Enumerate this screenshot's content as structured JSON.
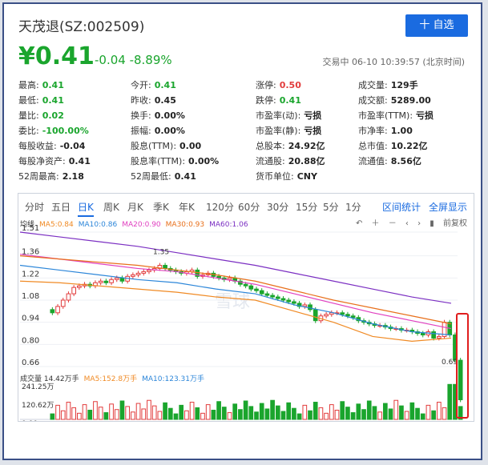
{
  "header": {
    "title": "天茂退(SZ:002509)",
    "add_button": "十 自选"
  },
  "quote": {
    "price": "¥0.41",
    "change": "-0.04 -8.89%",
    "status": "交易中 06-10 10:39:57 (北京时间)"
  },
  "stats": [
    [
      {
        "label": "最高:",
        "value": "0.41",
        "color": "g"
      },
      {
        "label": "今开:",
        "value": "0.41",
        "color": "g"
      },
      {
        "label": "涨停:",
        "value": "0.50",
        "color": "r"
      },
      {
        "label": "成交量:",
        "value": "129手",
        "color": "k"
      }
    ],
    [
      {
        "label": "最低:",
        "value": "0.41",
        "color": "g"
      },
      {
        "label": "昨收:",
        "value": "0.45",
        "color": "k"
      },
      {
        "label": "跌停:",
        "value": "0.41",
        "color": "g"
      },
      {
        "label": "成交额:",
        "value": "5289.00",
        "color": "k"
      }
    ],
    [
      {
        "label": "量比:",
        "value": "0.02",
        "color": "g"
      },
      {
        "label": "换手:",
        "value": "0.00%",
        "color": "k"
      },
      {
        "label": "市盈率(动):",
        "value": "亏损",
        "color": "k"
      },
      {
        "label": "市盈率(TTM):",
        "value": "亏损",
        "color": "k"
      }
    ],
    [
      {
        "label": "委比:",
        "value": "-100.00%",
        "color": "g"
      },
      {
        "label": "振幅:",
        "value": "0.00%",
        "color": "k"
      },
      {
        "label": "市盈率(静):",
        "value": "亏损",
        "color": "k"
      },
      {
        "label": "市净率:",
        "value": "1.00",
        "color": "k"
      }
    ],
    [
      {
        "label": "每股收益:",
        "value": "-0.04",
        "color": "k"
      },
      {
        "label": "股息(TTM):",
        "value": "0.00",
        "color": "k"
      },
      {
        "label": "总股本:",
        "value": "24.92亿",
        "color": "k"
      },
      {
        "label": "总市值:",
        "value": "10.22亿",
        "color": "k"
      }
    ],
    [
      {
        "label": "每股净资产:",
        "value": "0.41",
        "color": "k"
      },
      {
        "label": "股息率(TTM):",
        "value": "0.00%",
        "color": "k"
      },
      {
        "label": "流通股:",
        "value": "20.88亿",
        "color": "k"
      },
      {
        "label": "流通值:",
        "value": "8.56亿",
        "color": "k"
      }
    ],
    [
      {
        "label": "52周最高:",
        "value": "2.18",
        "color": "k"
      },
      {
        "label": "52周最低:",
        "value": "0.41",
        "color": "k"
      },
      {
        "label": "货币单位:",
        "value": "CNY",
        "color": "k"
      }
    ]
  ],
  "tabs": [
    "分时",
    "五日",
    "日K",
    "周K",
    "月K",
    "季K",
    "年K",
    "120分",
    "60分",
    "30分",
    "15分",
    "5分",
    "1分"
  ],
  "active_tab": "日K",
  "tool_links": [
    "区间统计",
    "全屏显示"
  ],
  "ma_legend": [
    {
      "text": "均线",
      "color": "#333333"
    },
    {
      "text": "MA5:0.84",
      "color": "#f08a24"
    },
    {
      "text": "MA10:0.86",
      "color": "#2c86d9"
    },
    {
      "text": "MA20:0.90",
      "color": "#e040c0"
    },
    {
      "text": "MA30:0.93",
      "color": "#e86f1a"
    },
    {
      "text": "MA60:1.06",
      "color": "#7b2fc2"
    }
  ],
  "chart_controls": {
    "fq_label": "前复权"
  },
  "price_axis": {
    "ticks": [
      "1.51",
      "1.36",
      "1.22",
      "1.08",
      "0.94",
      "0.80",
      "0.66"
    ],
    "max_label": "1.35",
    "min_label": "0.69"
  },
  "volume_legend": [
    {
      "text": "成交量 14.42万手",
      "color": "#333333"
    },
    {
      "text": "MA5:152.8万手",
      "color": "#f08a24"
    },
    {
      "text": "MA10:123.31万手",
      "color": "#2c86d9"
    }
  ],
  "volume_axis": {
    "ticks": [
      "241.25万",
      "120.62万",
      "0.00"
    ]
  },
  "watermark": "雪球",
  "colors": {
    "up": "#e23c3c",
    "down": "#1aa52d",
    "accent": "#1a6be0",
    "highlight": "#e01d1d"
  },
  "chart_data": {
    "type": "candlestick",
    "ylim": [
      0.66,
      1.51
    ],
    "closes": [
      1.0,
      1.04,
      1.08,
      1.12,
      1.16,
      1.17,
      1.18,
      1.17,
      1.19,
      1.2,
      1.19,
      1.21,
      1.22,
      1.2,
      1.23,
      1.24,
      1.25,
      1.26,
      1.27,
      1.28,
      1.3,
      1.28,
      1.27,
      1.26,
      1.25,
      1.26,
      1.27,
      1.23,
      1.24,
      1.25,
      1.23,
      1.22,
      1.21,
      1.22,
      1.2,
      1.18,
      1.17,
      1.15,
      1.14,
      1.12,
      1.11,
      1.1,
      1.09,
      1.08,
      1.07,
      1.06,
      1.04,
      1.05,
      1.02,
      0.95,
      0.98,
      0.99,
      1.0,
      1.0,
      0.99,
      0.98,
      0.97,
      0.95,
      0.94,
      0.93,
      0.92,
      0.92,
      0.91,
      0.9,
      0.9,
      0.89,
      0.89,
      0.88,
      0.87,
      0.86,
      0.88,
      0.84,
      0.85,
      0.94,
      0.86,
      0.7,
      0.45
    ],
    "series": [
      {
        "name": "MA5",
        "values": [
          1.2,
          1.19,
          1.17,
          1.15,
          1.13,
          1.1,
          1.08,
          1.01,
          0.94,
          0.85,
          0.82,
          0.84
        ]
      },
      {
        "name": "MA10",
        "values": [
          1.3,
          1.27,
          1.24,
          1.21,
          1.19,
          1.15,
          1.12,
          1.05,
          1.0,
          0.93,
          0.88,
          0.86
        ]
      },
      {
        "name": "MA20",
        "values": [
          1.37,
          1.34,
          1.31,
          1.28,
          1.26,
          1.22,
          1.18,
          1.12,
          1.06,
          1.0,
          0.95,
          0.9
        ]
      },
      {
        "name": "MA30",
        "values": [
          1.36,
          1.34,
          1.32,
          1.3,
          1.27,
          1.24,
          1.2,
          1.14,
          1.08,
          1.03,
          0.98,
          0.93
        ]
      },
      {
        "name": "MA60",
        "values": [
          1.51,
          1.48,
          1.45,
          1.42,
          1.38,
          1.34,
          1.3,
          1.25,
          1.2,
          1.15,
          1.1,
          1.06
        ]
      }
    ],
    "volume_ylim": [
      0,
      241.25
    ]
  }
}
